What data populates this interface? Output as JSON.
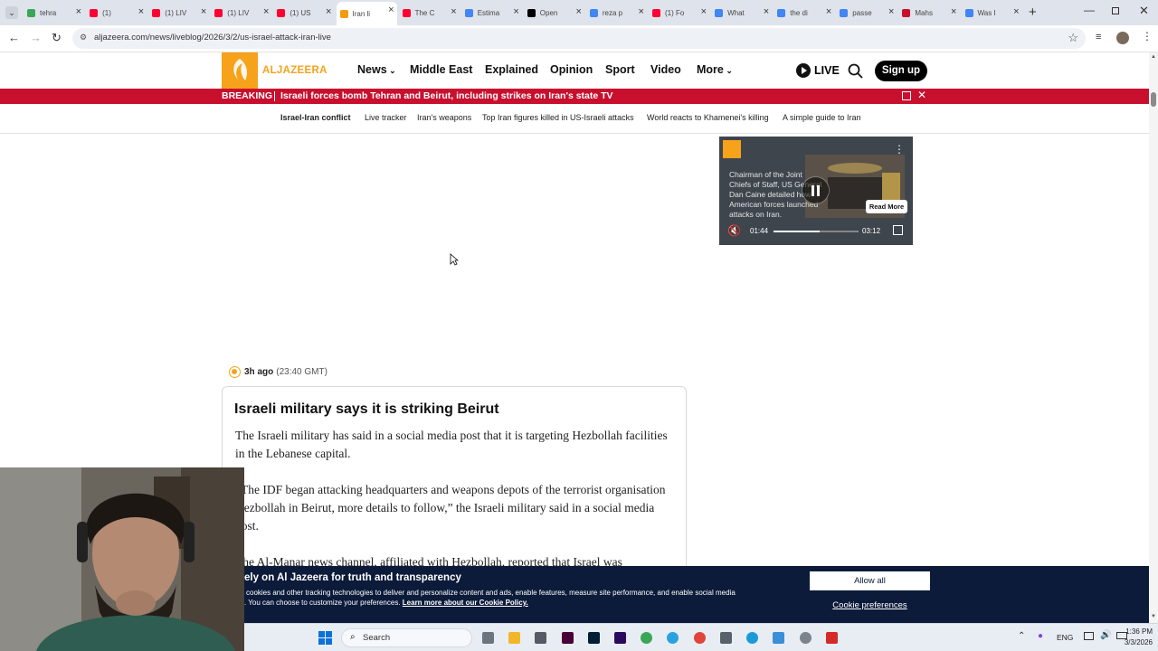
{
  "browser": {
    "tabs": [
      {
        "label": "tehra",
        "color": "#3aa757"
      },
      {
        "label": "(1)",
        "color": "#ff0033"
      },
      {
        "label": "(1) LIV",
        "color": "#ff0033"
      },
      {
        "label": "(1) LIV",
        "color": "#ff0033"
      },
      {
        "label": "(1) US",
        "color": "#ff0033"
      },
      {
        "label": "Iran li",
        "color": "#f39c12"
      },
      {
        "label": "The C",
        "color": "#ff0033"
      },
      {
        "label": "Estima",
        "color": "#4285f4"
      },
      {
        "label": "Open",
        "color": "#000000"
      },
      {
        "label": "reza p",
        "color": "#4285f4"
      },
      {
        "label": "(1) Fo",
        "color": "#ff0033"
      },
      {
        "label": "What",
        "color": "#4285f4"
      },
      {
        "label": "the di",
        "color": "#4285f4"
      },
      {
        "label": "passe",
        "color": "#4285f4"
      },
      {
        "label": "Mahs",
        "color": "#c8102e"
      },
      {
        "label": "Was I",
        "color": "#4285f4"
      }
    ],
    "url": "aljazeera.com/news/liveblog/2026/3/2/us-israel-attack-iran-live"
  },
  "site": {
    "logo_text": "ALJAZEERA",
    "nav": [
      "News",
      "Middle East",
      "Explained",
      "Opinion",
      "Sport",
      "Video",
      "More"
    ],
    "live_label": "LIVE",
    "signup_label": "Sign up",
    "brand_color": "#f7a21b"
  },
  "breaking": {
    "label": "BREAKING",
    "text": "Israeli forces bomb Tehran and Beirut, including strikes on Iran's state TV"
  },
  "subnav": [
    "Israel-Iran conflict",
    "Live tracker",
    "Iran's weapons",
    "Top Iran figures killed in US-Israeli attacks",
    "World reacts to Khamenei's killing",
    "A simple guide to Iran"
  ],
  "video": {
    "caption": "Chairman of the Joint Chiefs of Staff, US General Dan Caine detailed how American forces launched attacks on Iran.",
    "read_more": "Read More",
    "current_time": "01:44",
    "duration": "03:12",
    "progress": 0.54
  },
  "post": {
    "time_ago": "3h ago",
    "gmt": "(23:40 GMT)",
    "title": "Israeli military says it is striking Beirut",
    "para1": "The Israeli military has said in a social media post that it is targeting Hezbollah facilities in the Lebanese capital.",
    "para2": "“The IDF began attacking headquarters and weapons depots of the terrorist organisation Hezbollah in Beirut, more details to follow,” the Israeli military said in a social media post.",
    "para3": "The Al-Manar news channel, affiliated with Hezbollah, reported that Israel was"
  },
  "cookie": {
    "title": "ely on Al Jazeera for truth and transparency",
    "line1": "cookies and other tracking technologies to deliver and personalize content and ads, enable features, measure site performance, and enable social media",
    "line2": ". You can choose to customize your preferences.",
    "link": "Learn more about our Cookie Policy.",
    "allow": "Allow all",
    "prefs": "Cookie preferences"
  },
  "taskbar": {
    "search": "Search",
    "lang": "ENG",
    "time": "1:36 PM",
    "date": "3/3/2026"
  }
}
